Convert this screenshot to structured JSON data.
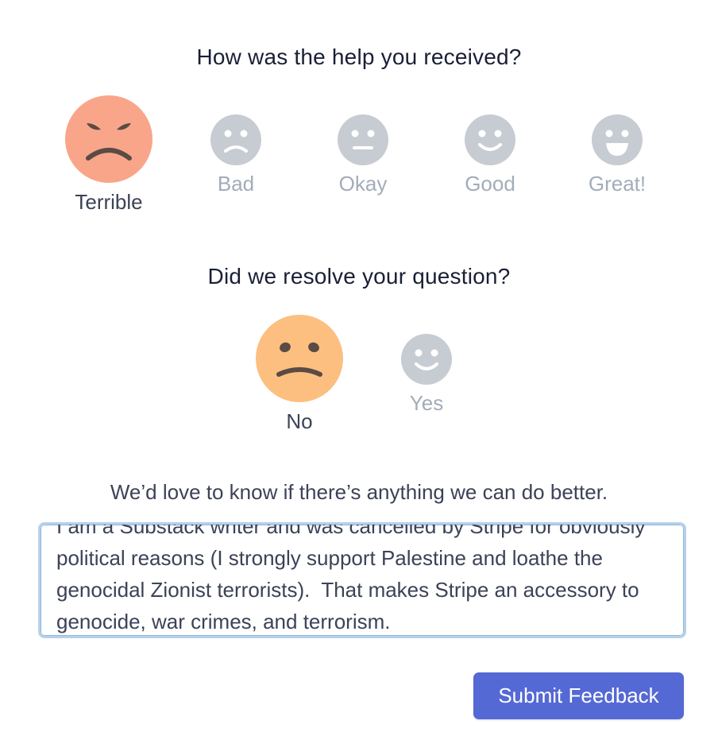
{
  "rating": {
    "question": "How was the help you received?",
    "options": [
      {
        "label": "Terrible",
        "selected": true
      },
      {
        "label": "Bad",
        "selected": false
      },
      {
        "label": "Okay",
        "selected": false
      },
      {
        "label": "Good",
        "selected": false
      },
      {
        "label": "Great!",
        "selected": false
      }
    ]
  },
  "resolved": {
    "question": "Did we resolve your question?",
    "options": [
      {
        "label": "No",
        "selected": true
      },
      {
        "label": "Yes",
        "selected": false
      }
    ]
  },
  "feedback": {
    "prompt": "We’d love to know if there’s anything we can do better.",
    "value": "I am a Substack writer and was cancelled by Stripe for obviously political reasons (I strongly support Palestine and loathe the genocidal Zionist terrorists).  That makes Stripe an accessory to genocide, war crimes, and terrorism."
  },
  "submit": {
    "label": "Submit Feedback"
  },
  "colors": {
    "terrible_face": "#f9a58a",
    "no_face": "#fcbf80",
    "inactive_face": "#c7ccd3",
    "feature_dark": "#5a4b44",
    "button": "#5469d4",
    "textarea_border": "#b6d2ea"
  }
}
